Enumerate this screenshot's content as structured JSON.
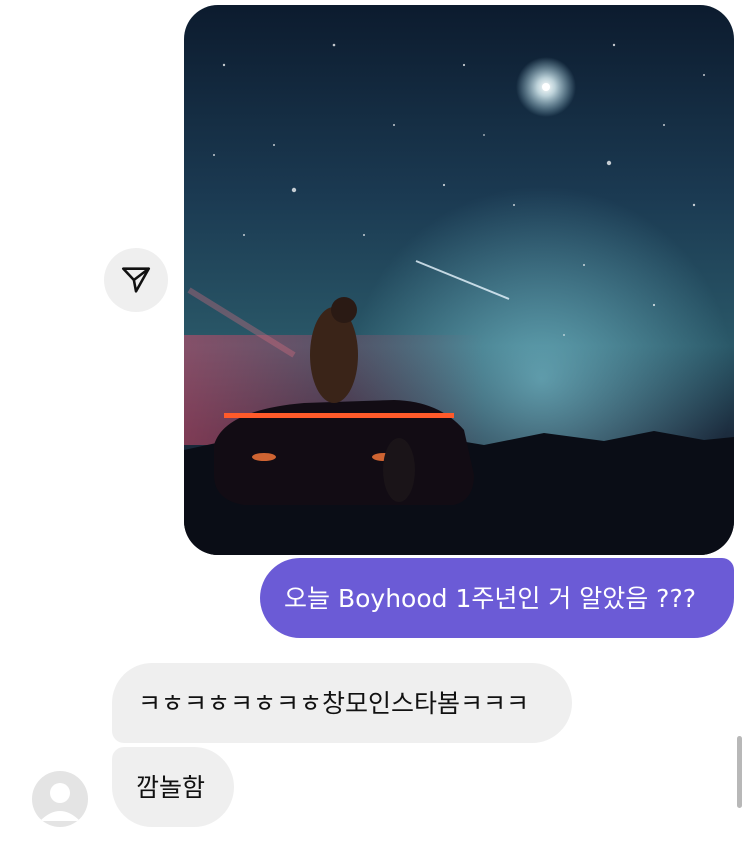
{
  "messages": [
    {
      "id": "m1",
      "kind": "image",
      "direction": "outgoing",
      "image_subject": "night-sky-car-photo"
    },
    {
      "id": "m2",
      "kind": "text",
      "direction": "outgoing",
      "text": "오늘 Boyhood 1주년인 거 알았음 ???"
    },
    {
      "id": "m3",
      "kind": "text",
      "direction": "incoming",
      "text": "ㅋㅎㅋㅎㅋㅎㅋㅎ창모인스타봄ㅋㅋㅋ"
    },
    {
      "id": "m4",
      "kind": "text",
      "direction": "incoming",
      "text": "깜놀함"
    }
  ],
  "share_button": {
    "icon": "paper-plane-icon"
  },
  "avatar": {
    "icon": "default-profile-icon"
  },
  "colors": {
    "sent_bubble": "#6b5bd6",
    "received_bubble": "#efefef",
    "share_button_bg": "#efefef"
  }
}
